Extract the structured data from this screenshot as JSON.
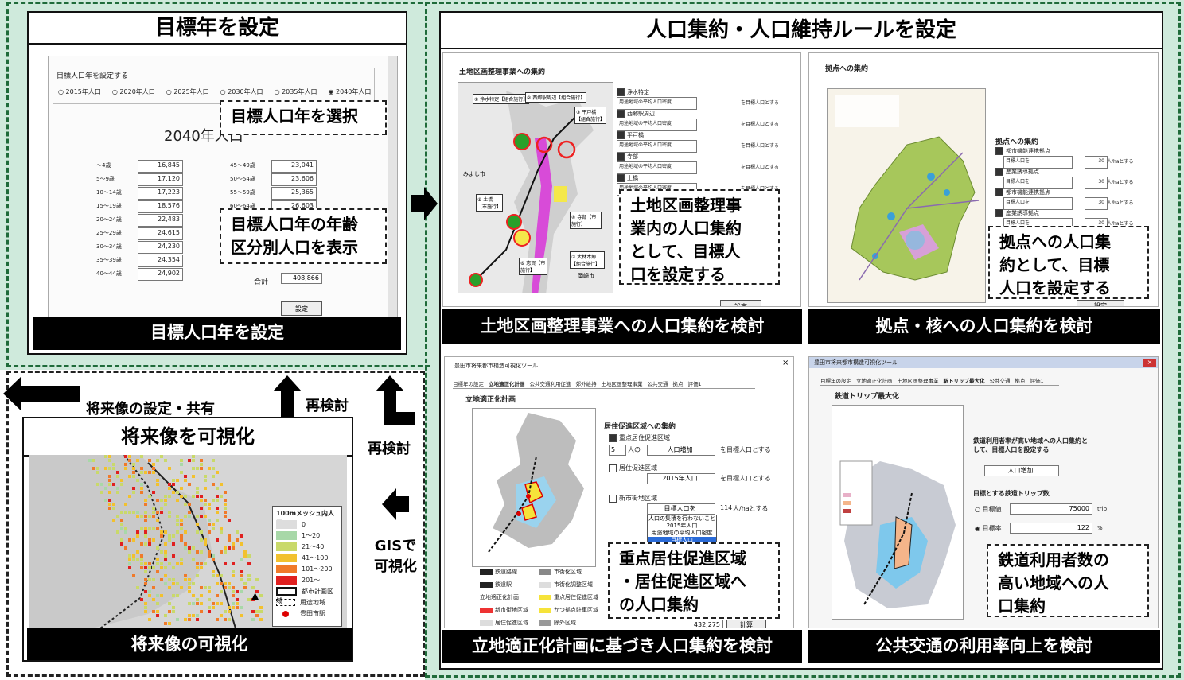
{
  "panel_target_year": {
    "title": "目標年を設定",
    "form_title": "目標人口年を設定する",
    "year_options": [
      "2015年人口",
      "2020年人口",
      "2025年人口",
      "2030年人口",
      "2035年人口",
      "2040年人口"
    ],
    "selected_year": "2040年人口",
    "big_label": "2040年人口",
    "ages_left": [
      {
        "label": "～4歳",
        "value": "16,845"
      },
      {
        "label": "5～9歳",
        "value": "17,120"
      },
      {
        "label": "10～14歳",
        "value": "17,223"
      },
      {
        "label": "15～19歳",
        "value": "18,576"
      },
      {
        "label": "20～24歳",
        "value": "22,483"
      },
      {
        "label": "25～29歳",
        "value": "24,615"
      },
      {
        "label": "30～34歳",
        "value": "24,230"
      },
      {
        "label": "35～39歳",
        "value": "24,354"
      },
      {
        "label": "40～44歳",
        "value": "24,902"
      }
    ],
    "ages_right": [
      {
        "label": "45～49歳",
        "value": "23,041"
      },
      {
        "label": "50～54歳",
        "value": "23,606"
      },
      {
        "label": "55～59歳",
        "value": "25,365"
      },
      {
        "label": "60～64歳",
        "value": "26,603"
      }
    ],
    "total_label": "合計",
    "total_value": "408,866",
    "set_button": "設定",
    "callout_select": "目標人口年を選択",
    "callout_age": "目標人口年の年齢\n区分別人口を表示",
    "footer": "目標人口年を設定"
  },
  "panel_rules": {
    "title": "人口集約・人口維持ルールを設定"
  },
  "sub_land": {
    "screen_title": "土地区画整理事業への集約",
    "map_labels": [
      "① 浄水特定【組合施行】",
      "② 西郷駅周辺【組合施行】",
      "③ 平戸橋【組合施行】",
      "⑤ 土橋【市施行】",
      "④ 寺部【市施行】",
      "⑥ 志賀【市施行】",
      "⑦ 大林本郷【組合施行】",
      "みよし市",
      "岡崎市"
    ],
    "items": [
      "浄水特定",
      "西郷駅周辺",
      "平戸橋",
      "寺部",
      "土橋"
    ],
    "select_value": "用途地域の平均人口密度",
    "suffix": "を目標人口とする",
    "callout": "土地区画整理事\n業内の人口集約\nとして、目標人\n口を設定する",
    "button": "設定",
    "footer": "土地区画整理事業への人口集約を検討"
  },
  "sub_hub": {
    "screen_title": "拠点への集約",
    "section": "拠点への集約",
    "items": [
      "都市機能連携拠点",
      "産業誘導拠点",
      "都市機能連携拠点",
      "産業誘導拠点"
    ],
    "select_value": "目標人口を",
    "field_value": "30",
    "unit": "人/haとする",
    "callout": "拠点への人口集\n約として、目標\n人口を設定する",
    "button": "設定",
    "footer": "拠点・核への人口集約を検討"
  },
  "sub_location": {
    "window_title": "豊田市将来都市構造可視化ツール",
    "tabs": [
      "目標年の設定",
      "立地適正化計画",
      "公共交通利用促進",
      "郊外維持",
      "土地区画整理事業",
      "公共交通",
      "拠点",
      "評価1"
    ],
    "screen_title": "立地適正化計画",
    "section": "居住促進区域への集約",
    "opt1": "重点居住促進区域",
    "opt1_value": "5",
    "opt1_unit": "人の",
    "opt1_select": "人口増加",
    "opt2": "居住促進区域",
    "opt2_select": "2015年人口",
    "opt3": "新市街地区域",
    "opt3_select": "目標人口を",
    "opt3_value": "114",
    "opt3_unit": "人/haとする",
    "suffix": "を目標人口とする",
    "dropdown_options": [
      "人口の集積を行わないこと",
      "2015年人口",
      "用途地域の平均人口密度",
      "目標人口",
      "人口増加"
    ],
    "legend": [
      "鉄道路線",
      "市街化区域",
      "鉄道駅",
      "市街化調整区域",
      "立地適正化計画",
      "重点居住促進区域",
      "新市街地区域",
      "かつ拠点駐車区域",
      "居住促進区域",
      "除外区域"
    ],
    "total_value": "432,275",
    "button": "計算",
    "callout": "重点居住促進区域\n・居住促進区域へ\nの人口集約",
    "footer": "立地適正化計画に基づき人口集約を検討"
  },
  "sub_transit": {
    "window_title": "豊田市将来都市構造可視化ツール",
    "tabs": [
      "目標年の設定",
      "立地適正化計画",
      "土地区画整理事業",
      "駅トリップ最大化",
      "公共交通",
      "拠点",
      "評価1"
    ],
    "screen_title": "鉄道トリップ最大化",
    "desc": "鉄道利用者率が高い地域への人口集約として、目標人口を設定する",
    "select_value": "人口増加",
    "target_label": "目標とする鉄道トリップ数",
    "opt1": "目標値",
    "opt1_value": "75000",
    "opt1_unit": "trip",
    "opt2": "目標率",
    "opt2_value": "122",
    "opt2_unit": "%",
    "callout": "鉄道利用者数の\n高い地域への人\n口集約",
    "footer": "公共交通の利用率向上を検討"
  },
  "panel_future": {
    "title": "将来像を可視化",
    "legend_title": "100mメッシュ内人口",
    "legend_items": [
      "0",
      "1～20",
      "21～40",
      "41～100",
      "101～200",
      "201～",
      "都市計画区域",
      "用途地域",
      "豊田市駅"
    ],
    "footer": "将来像の可視化"
  },
  "arrows": {
    "share": "将来像の設定・共有",
    "recheck1": "再検討",
    "recheck2": "再検討",
    "gis": "GISで\n可視化"
  },
  "colors": {
    "green_border": "#1f6b3a",
    "mint_bg": "#cfeadc",
    "legend_colors": [
      "#dddddd",
      "#a8d8a8",
      "#c9d96a",
      "#f2c12e",
      "#f07a2a",
      "#e02020"
    ]
  }
}
